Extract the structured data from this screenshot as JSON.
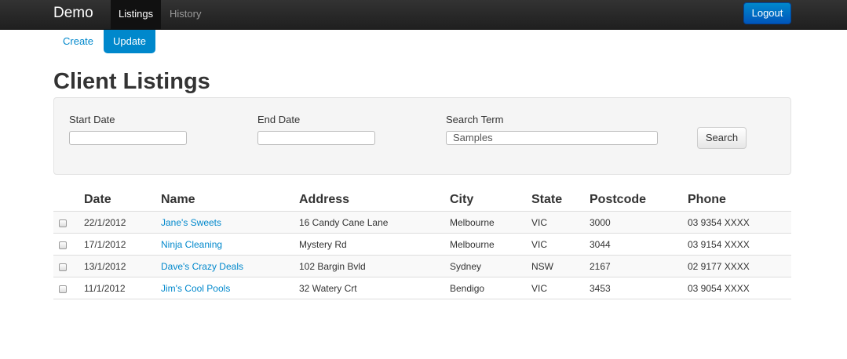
{
  "navbar": {
    "brand": "Demo",
    "tabs": [
      {
        "label": "Listings",
        "active": true
      },
      {
        "label": "History",
        "active": false
      }
    ],
    "logout_label": "Logout"
  },
  "subnav": {
    "pills": [
      {
        "label": "Create",
        "active": false
      },
      {
        "label": "Update",
        "active": true
      }
    ]
  },
  "page_title": "Client Listings",
  "search": {
    "start_date_label": "Start Date",
    "start_date_value": "",
    "end_date_label": "End Date",
    "end_date_value": "",
    "term_label": "Search Term",
    "term_value": "Samples",
    "button_label": "Search"
  },
  "table": {
    "columns": [
      "Date",
      "Name",
      "Address",
      "City",
      "State",
      "Postcode",
      "Phone"
    ],
    "rows": [
      {
        "date": "22/1/2012",
        "name": "Jane's Sweets",
        "address": "16 Candy Cane Lane",
        "city": "Melbourne",
        "state": "VIC",
        "postcode": "3000",
        "phone": "03 9354 XXXX"
      },
      {
        "date": "17/1/2012",
        "name": "Ninja Cleaning",
        "address": "Mystery Rd",
        "city": "Melbourne",
        "state": "VIC",
        "postcode": "3044",
        "phone": "03 9154 XXXX"
      },
      {
        "date": "13/1/2012",
        "name": "Dave's Crazy Deals",
        "address": "102 Bargin Bvld",
        "city": "Sydney",
        "state": "NSW",
        "postcode": "2167",
        "phone": "02 9177 XXXX"
      },
      {
        "date": "11/1/2012",
        "name": "Jim's Cool Pools",
        "address": "32 Watery Crt",
        "city": "Bendigo",
        "state": "VIC",
        "postcode": "3453",
        "phone": "03 9054 XXXX"
      }
    ]
  },
  "colors": {
    "accent": "#0088cc",
    "navbar": "#222222",
    "logout": "#0066cc"
  }
}
